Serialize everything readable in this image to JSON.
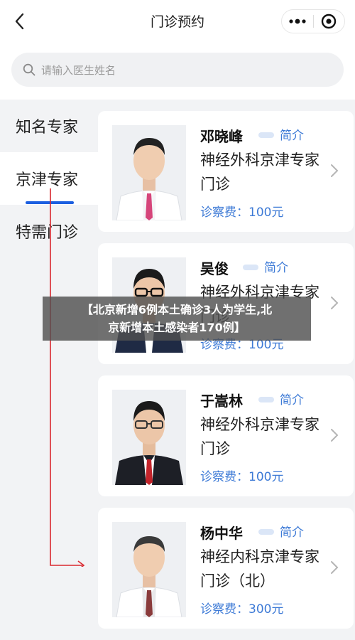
{
  "nav": {
    "title": "门诊预约",
    "back_icon": "chevron-left-icon",
    "more_icon": "more-dots-icon",
    "target_icon": "target-circle-icon"
  },
  "search": {
    "placeholder": "请输入医生姓名",
    "icon": "search-icon"
  },
  "sidebar": {
    "items": [
      {
        "label": "知名专家",
        "active": false
      },
      {
        "label": "京津专家",
        "active": true
      },
      {
        "label": "特需门诊",
        "active": false
      }
    ],
    "accent_color": "#1c5fe0"
  },
  "doctors": [
    {
      "name": "邓晓峰",
      "intro_label": "简介",
      "dept": "神经外科京津专家门诊",
      "fee": "诊察费：100元"
    },
    {
      "name": "吴俊",
      "intro_label": "简介",
      "dept": "神经外科京津专家门诊",
      "fee": "诊察费：100元"
    },
    {
      "name": "于嵩林",
      "intro_label": "简介",
      "dept": "神经外科京津专家门诊",
      "fee": "诊察费：100元"
    },
    {
      "name": "杨中华",
      "intro_label": "简介",
      "dept": "神经内科京津专家门诊（北）",
      "fee": "诊察费：300元"
    }
  ],
  "banner": {
    "line1": "【北京新增6例本土确诊3人为学生,北",
    "line2": "京新增本土感染者170例】"
  },
  "colors": {
    "link_blue": "#3d7ad6",
    "annotation_red": "#d9272e"
  }
}
